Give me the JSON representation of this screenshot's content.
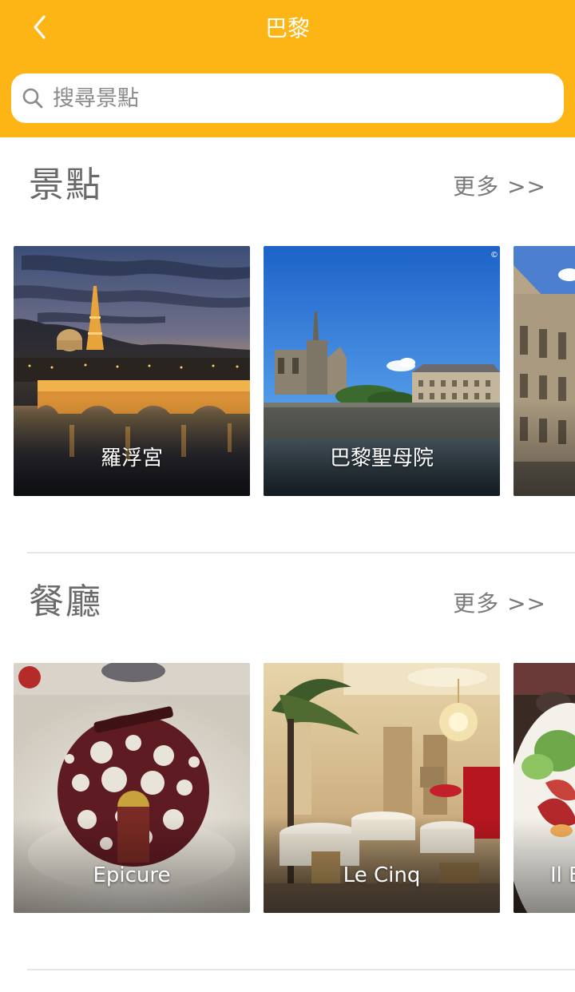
{
  "header": {
    "title": "巴黎",
    "back_icon": "chevron-left-icon",
    "background_color": "#FDB415"
  },
  "search": {
    "placeholder": "搜尋景點",
    "value": "",
    "icon": "search-icon"
  },
  "attractions": {
    "title": "景點",
    "more_label": "更多 >>",
    "cards": [
      {
        "label": "羅浮宮",
        "image": "night-bridge-eiffel-tower-photo"
      },
      {
        "label": "巴黎聖母院",
        "image": "notre-dame-cathedral-photo"
      },
      {
        "label": "",
        "image": "louvre-facade-photo"
      }
    ]
  },
  "restaurants": {
    "title": "餐廳",
    "more_label": "更多 >>",
    "cards": [
      {
        "label": "Epicure",
        "image": "chocolate-sphere-dessert-photo"
      },
      {
        "label": "Le Cinq",
        "image": "chandelier-dining-room-photo"
      },
      {
        "label": "Il E",
        "image": "salad-dish-photo"
      }
    ]
  }
}
